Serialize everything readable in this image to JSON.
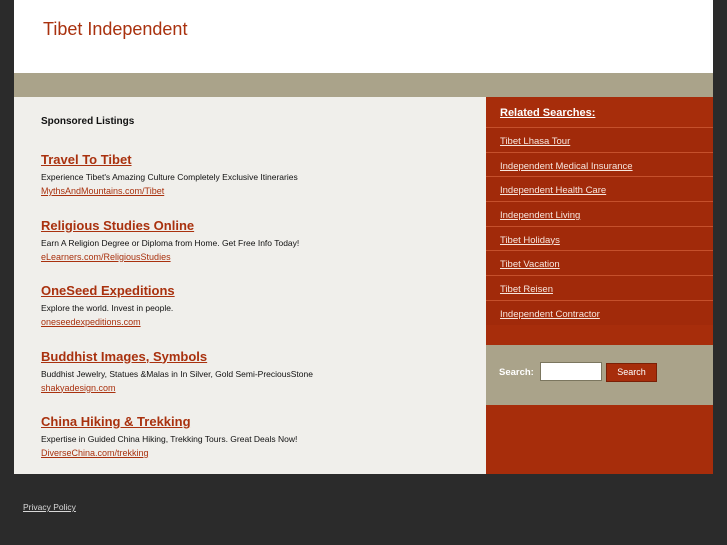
{
  "header": {
    "title": "Tibet Independent"
  },
  "main": {
    "sponsored_title": "Sponsored Listings",
    "listings": [
      {
        "title": "Travel To Tibet",
        "description": "Experience Tibet's Amazing Culture Completely Exclusive Itineraries",
        "url": "MythsAndMountains.com/Tibet"
      },
      {
        "title": "Religious Studies Online",
        "description": "Earn A Religion Degree or Diploma from Home. Get Free Info Today!",
        "url": "eLearners.com/ReligiousStudies"
      },
      {
        "title": "OneSeed Expeditions",
        "description": "Explore the world. Invest in people.",
        "url": "oneseedexpeditions.com"
      },
      {
        "title": "Buddhist Images, Symbols",
        "description": "Buddhist Jewelry, Statues &Malas in In Silver, Gold Semi-PreciousStone",
        "url": "shakyadesign.com"
      },
      {
        "title": "China Hiking & Trekking",
        "description": "Expertise in Guided China Hiking, Trekking Tours. Great Deals Now!",
        "url": "DiverseChina.com/trekking"
      }
    ]
  },
  "sidebar": {
    "heading": "Related Searches:",
    "items": [
      {
        "label": "Tibet Lhasa Tour"
      },
      {
        "label": "Independent Medical Insurance"
      },
      {
        "label": "Independent Health Care"
      },
      {
        "label": "Independent Living"
      },
      {
        "label": "Tibet Holidays"
      },
      {
        "label": "Tibet Vacation"
      },
      {
        "label": "Tibet Reisen"
      },
      {
        "label": "Independent Contractor"
      }
    ]
  },
  "search": {
    "label": "Search:",
    "value": "",
    "button_label": "Search"
  },
  "footer": {
    "privacy_label": "Privacy Policy"
  },
  "colors": {
    "accent": "#a9310e",
    "sidebar": "#a72d0b",
    "band": "#aaa38a",
    "background": "#2b2b2b"
  }
}
